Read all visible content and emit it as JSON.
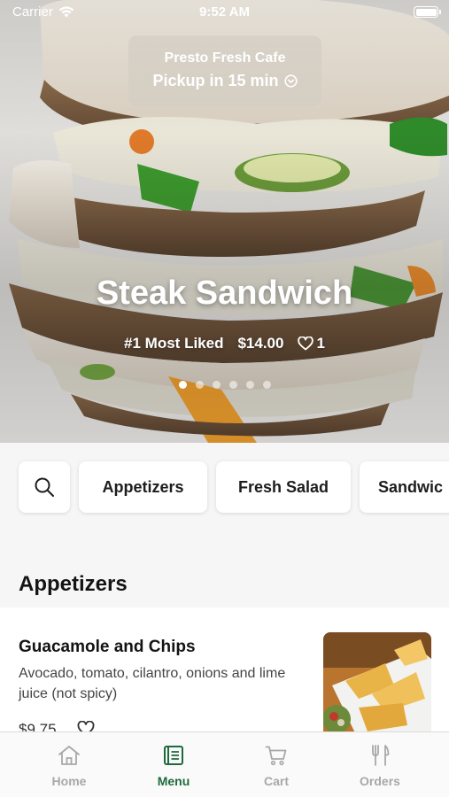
{
  "status_bar": {
    "carrier": "Carrier",
    "time": "9:52 AM"
  },
  "store": {
    "name": "Presto Fresh Cafe",
    "pickup": "Pickup in 15 min"
  },
  "featured": {
    "title": "Steak Sandwich",
    "rank": "#1 Most Liked",
    "price": "$14.00",
    "likes": "1",
    "carousel_pages": 6,
    "active_page": 1
  },
  "categories": [
    "Appetizers",
    "Fresh Salad",
    "Sandwic"
  ],
  "section": {
    "title": "Appetizers"
  },
  "items": [
    {
      "name": "Guacamole and Chips",
      "description": "Avocado, tomato, cilantro, onions and lime juice (not spicy)",
      "price": "$9.75"
    }
  ],
  "tabs": [
    {
      "label": "Home",
      "icon": "home-icon"
    },
    {
      "label": "Menu",
      "icon": "menu-icon",
      "active": true
    },
    {
      "label": "Cart",
      "icon": "cart-icon"
    },
    {
      "label": "Orders",
      "icon": "orders-icon"
    }
  ],
  "colors": {
    "accent": "#1d6a3e",
    "inactive": "#a8a8a8"
  }
}
